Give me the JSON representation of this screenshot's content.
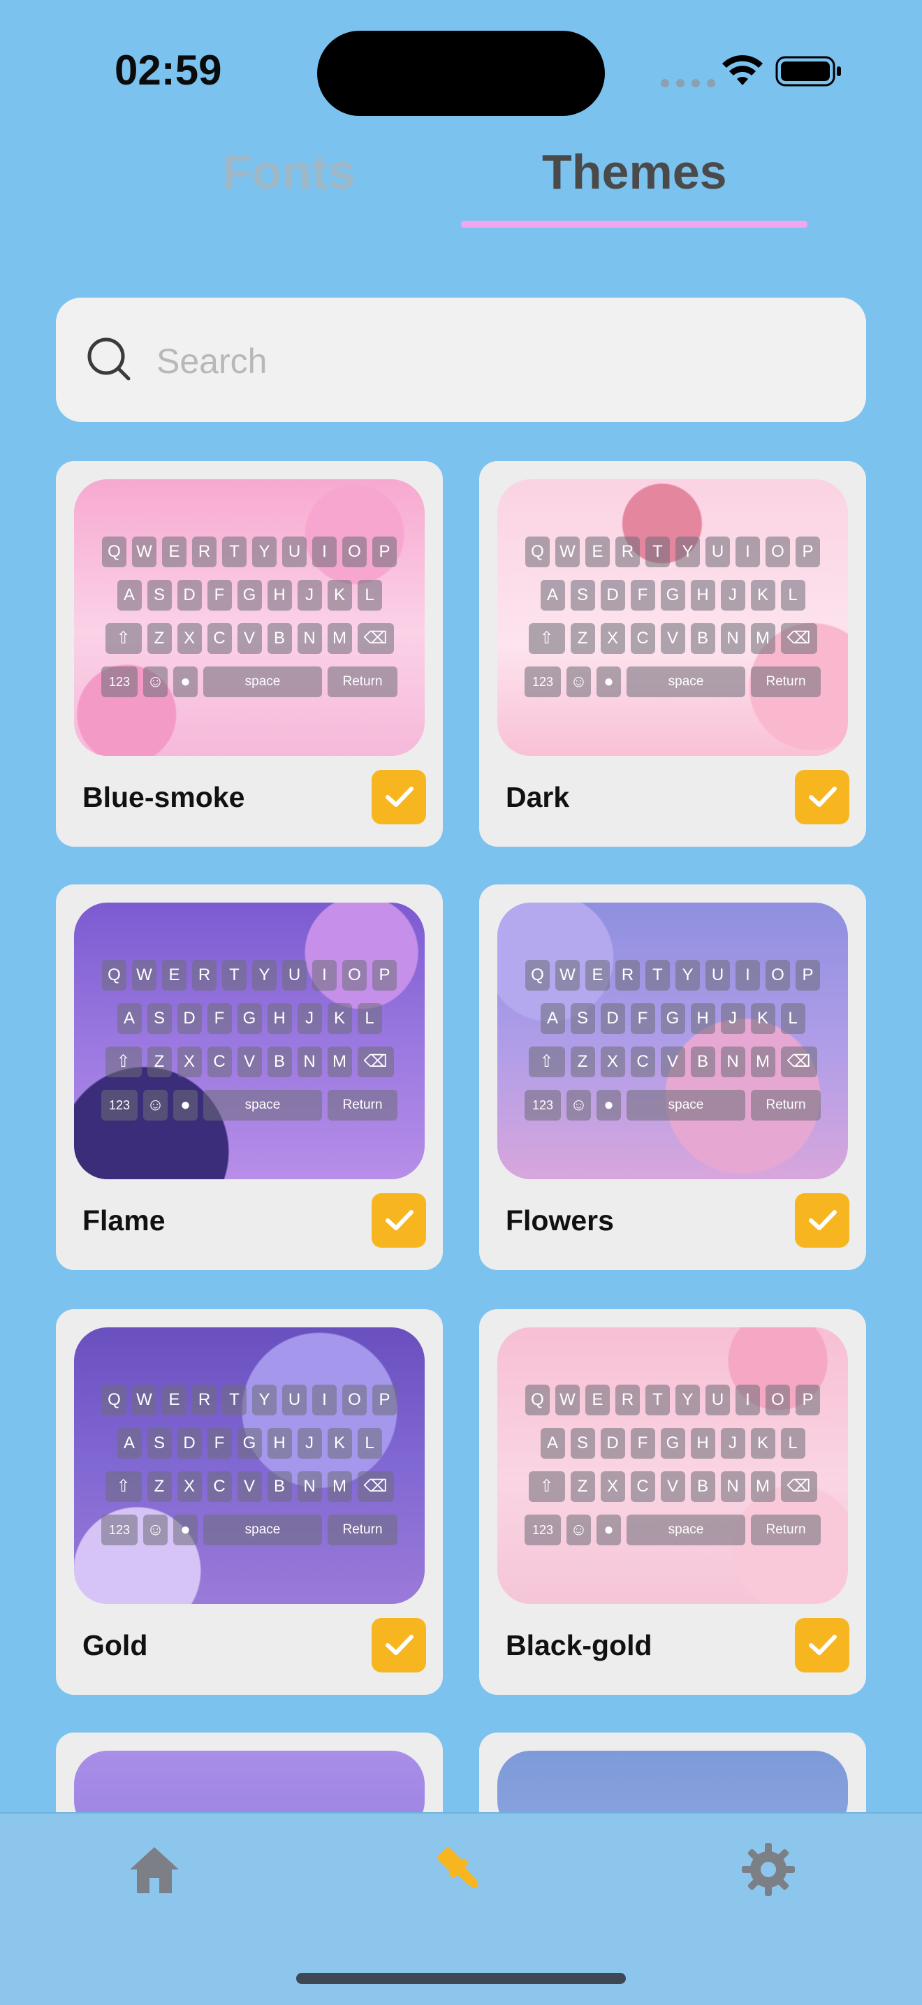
{
  "status_bar": {
    "time": "02:59"
  },
  "tabs": [
    {
      "label": "Fonts",
      "active": false
    },
    {
      "label": "Themes",
      "active": true
    }
  ],
  "search": {
    "placeholder": "Search",
    "value": ""
  },
  "keyboard": {
    "row1": [
      "Q",
      "W",
      "E",
      "R",
      "T",
      "Y",
      "U",
      "I",
      "O",
      "P"
    ],
    "row2": [
      "A",
      "S",
      "D",
      "F",
      "G",
      "H",
      "J",
      "K",
      "L"
    ],
    "row3": [
      "Z",
      "X",
      "C",
      "V",
      "B",
      "N",
      "M"
    ],
    "numbers_label": "123",
    "space_label": "space",
    "return_label": "Return"
  },
  "themes": [
    {
      "name": "Blue-smoke",
      "selected": true,
      "bg": "#f6b3d6"
    },
    {
      "name": "Dark",
      "selected": true,
      "bg": "#f9c9de"
    },
    {
      "name": "Flame",
      "selected": true,
      "bg": "#8a6bd6"
    },
    {
      "name": "Flowers",
      "selected": true,
      "bg": "#a69ae6"
    },
    {
      "name": "Gold",
      "selected": true,
      "bg": "#7e63c9"
    },
    {
      "name": "Black-gold",
      "selected": true,
      "bg": "#f6c6d8"
    }
  ],
  "accent_color": "#f7b620",
  "nav": [
    {
      "icon": "home-icon",
      "active": false
    },
    {
      "icon": "brush-icon",
      "active": true
    },
    {
      "icon": "gear-icon",
      "active": false
    }
  ]
}
